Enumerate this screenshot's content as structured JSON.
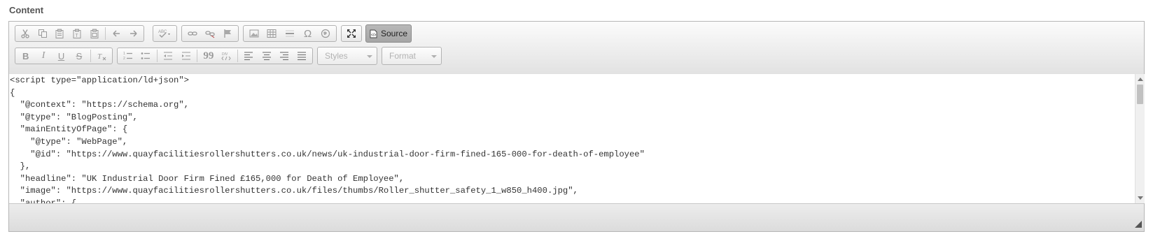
{
  "field": {
    "label": "Content"
  },
  "toolbar": {
    "source_label": "Source",
    "styles_placeholder": "Styles",
    "format_placeholder": "Format",
    "special_char_glyph": "Ω",
    "bold_glyph": "B",
    "italic_glyph": "I",
    "underline_glyph": "U",
    "strike_glyph": "S",
    "blockquote_glyph": "99"
  },
  "editor": {
    "source_code": "<script type=\"application/ld+json\">\n{\n  \"@context\": \"https://schema.org\",\n  \"@type\": \"BlogPosting\",\n  \"mainEntityOfPage\": {\n    \"@type\": \"WebPage\",\n    \"@id\": \"https://www.quayfacilitiesrollershutters.co.uk/news/uk-industrial-door-firm-fined-165-000-for-death-of-employee\"\n  },\n  \"headline\": \"UK Industrial Door Firm Fined £165,000 for Death of Employee\",\n  \"image\": \"https://www.quayfacilitiesrollershutters.co.uk/files/thumbs/Roller_shutter_safety_1_w850_h400.jpg\",\n  \"author\": {"
  },
  "icons": [
    "cut-icon",
    "copy-icon",
    "paste-icon",
    "paste-text-icon",
    "paste-word-icon",
    "undo-icon",
    "redo-icon",
    "spellcheck-icon",
    "link-icon",
    "unlink-icon",
    "anchor-icon",
    "image-icon",
    "table-icon",
    "horizontal-rule-icon",
    "special-char-icon",
    "iframe-icon",
    "maximize-icon",
    "source-icon",
    "bold-icon",
    "italic-icon",
    "underline-icon",
    "strike-icon",
    "remove-format-icon",
    "numbered-list-icon",
    "bulleted-list-icon",
    "outdent-icon",
    "indent-icon",
    "blockquote-icon",
    "div-icon",
    "align-left-icon",
    "align-center-icon",
    "align-right-icon",
    "justify-icon",
    "resize-grip-icon"
  ]
}
